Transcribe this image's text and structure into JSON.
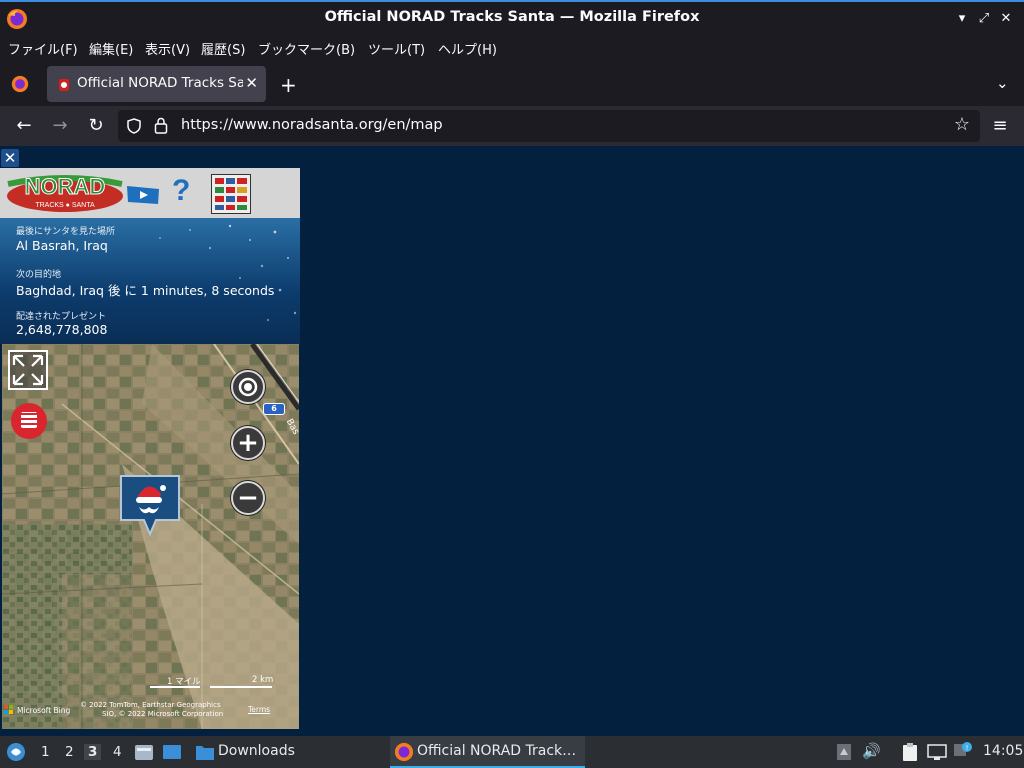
{
  "window": {
    "title": "Official NORAD Tracks Santa — Mozilla Firefox"
  },
  "menu": [
    "ファイル(F)",
    "編集(E)",
    "表示(V)",
    "履歴(S)",
    "ブックマーク(B)",
    "ツール(T)",
    "ヘルプ(H)"
  ],
  "tab": {
    "label": "Official NORAD Tracks Santa"
  },
  "urlbar": {
    "url": "https://www.noradsanta.org/en/map"
  },
  "info": {
    "last_seen_label": "最後にサンタを見た場所",
    "last_seen_value": "Al Basrah, Iraq",
    "next_dest_label": "次の目的地",
    "next_dest_value": "Baghdad, Iraq 後 に 1 minutes, 8 seconds",
    "presents_label": "配達されたプレゼント",
    "presents_value": "2,648,778,808"
  },
  "logo": {
    "text": "NORAD",
    "subtext": "TRACKS SANTA"
  },
  "map": {
    "road_label": "6",
    "road_text": "Bas",
    "scale_miles": "1 マイル",
    "scale_km": "2 km",
    "bing": "Microsoft Bing",
    "copyright_line1": "© 2022 TomTom, Earthstar Geographics",
    "copyright_line2": "SIO, © 2022 Microsoft Corporation",
    "terms": "Terms"
  },
  "taskbar": {
    "workspaces": [
      "1",
      "2",
      "3",
      "4"
    ],
    "active_workspace": "3",
    "downloads_label": "Downloads",
    "firefox_task": "Official NORAD Track…",
    "clock": "14:05"
  },
  "colors": {
    "page_bg": "#03203f",
    "accent": "#3b8ede",
    "toolbar": "#2b2a33",
    "titlebar": "#1c1b22"
  }
}
